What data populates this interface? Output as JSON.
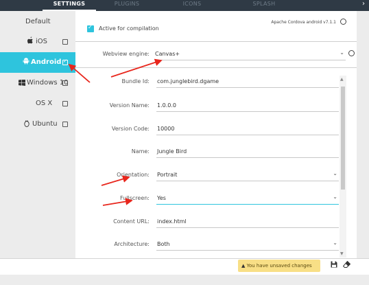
{
  "tabs": [
    {
      "label": "SETTINGS",
      "active": true
    },
    {
      "label": "PLUGINS",
      "active": false
    },
    {
      "label": "ICONS",
      "active": false
    },
    {
      "label": "SPLASH",
      "active": false
    }
  ],
  "tab_chevron": "›",
  "sidebar": {
    "default_label": "Default",
    "items": [
      {
        "label": "iOS",
        "icon": "apple-icon",
        "icon_char": "",
        "checked": false
      },
      {
        "label": "Android",
        "icon": "android-icon",
        "icon_char": "",
        "checked": true
      },
      {
        "label": "Windows 10",
        "icon": "windows-icon",
        "icon_char": "",
        "checked": false
      },
      {
        "label": "OS X",
        "icon": "osx-icon",
        "icon_char": "X",
        "checked": false
      },
      {
        "label": "Ubuntu",
        "icon": "ubuntu-icon",
        "icon_char": "",
        "checked": false
      }
    ]
  },
  "main": {
    "compile_label": "Active for compilation",
    "cordova_label": "Apache Cordova android v7.1.1",
    "fields": {
      "webview": {
        "label": "Webview engine:",
        "value": "Canvas+"
      },
      "bundle": {
        "label": "Bundle Id:",
        "value": "com.junglebird.dgame"
      },
      "version_name": {
        "label": "Version Name:",
        "value": "1.0.0.0"
      },
      "version_code": {
        "label": "Version Code:",
        "value": "10000"
      },
      "name": {
        "label": "Name:",
        "value": "Jungle Bird"
      },
      "orientation": {
        "label": "Orientation:",
        "value": "Portrait"
      },
      "fullscreen": {
        "label": "Fullscreen:",
        "value": "Yes"
      },
      "content_url": {
        "label": "Content URL:",
        "value": "index.html"
      },
      "architecture": {
        "label": "Architecture:",
        "value": "Both"
      }
    }
  },
  "footer": {
    "warning": "You have unsaved changes"
  },
  "colors": {
    "accent": "#2ec4dd",
    "topbar": "#2f3a45",
    "warning_bg": "#f8df86",
    "annotation_arrow": "#e8261c"
  }
}
